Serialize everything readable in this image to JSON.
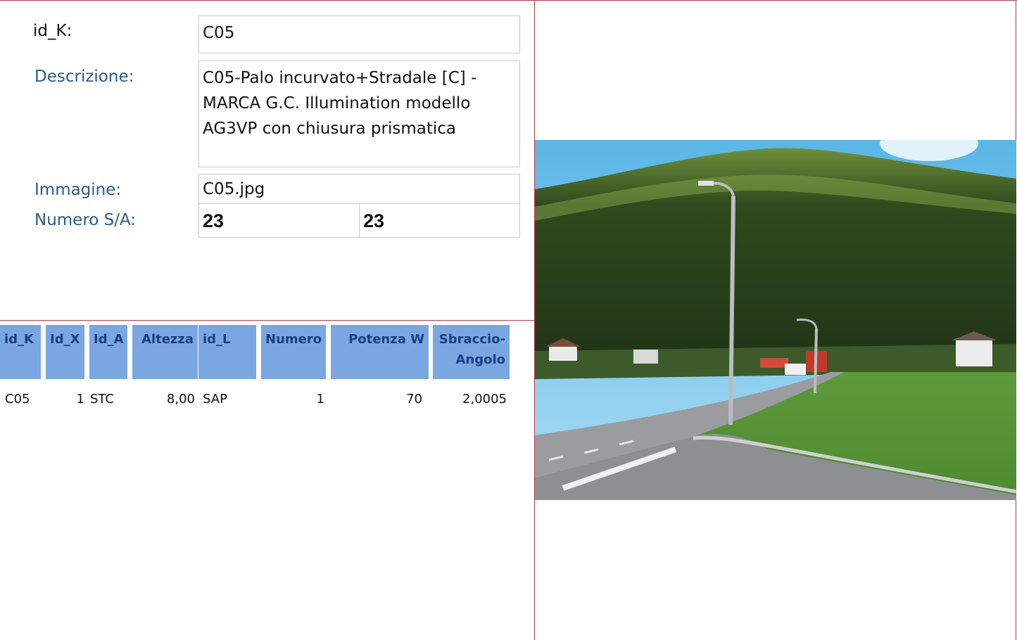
{
  "form": {
    "id_k_label": "id_K:",
    "id_k_value": "C05",
    "descrizione_label": "Descrizione:",
    "descrizione_value": "C05-Palo incurvato+Stradale [C] - MARCA G.C. Illumination modello AG3VP con chiusura prismatica",
    "immagine_label": "Immagine:",
    "immagine_value": "C05.jpg",
    "numero_label": "Numero S/A:",
    "numero_s": "23",
    "numero_a": "23"
  },
  "table": {
    "headers": [
      "id_K",
      "Id_X",
      "Id_A",
      "Altezza",
      "id_L",
      "Numero",
      "Potenza W",
      "Sbraccio-Angolo"
    ],
    "rows": [
      [
        "C05",
        "1",
        "STC",
        "8,00",
        "SAP",
        "1",
        "70",
        "2,0005"
      ]
    ]
  },
  "colors": {
    "border_accent": "#b23a48",
    "label_blue": "#2d5a8c",
    "header_bg": "#7aa6e2",
    "header_text": "#1a3f86"
  },
  "image": {
    "icon": "landscape-photo"
  }
}
